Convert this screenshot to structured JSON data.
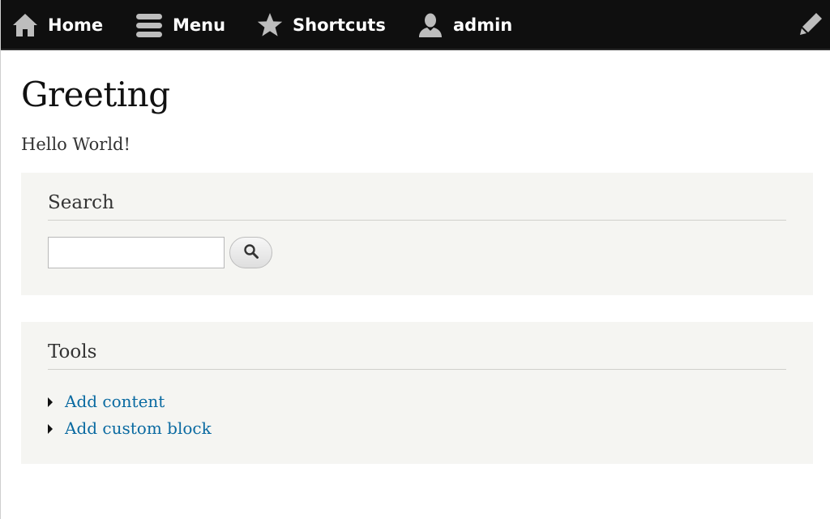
{
  "toolbar": {
    "background": "#0f0f0f",
    "items": [
      {
        "label": "Home",
        "icon": "home-icon"
      },
      {
        "label": "Menu",
        "icon": "hamburger-menu-icon"
      },
      {
        "label": "Shortcuts",
        "icon": "star-icon"
      },
      {
        "label": "admin",
        "icon": "user-icon"
      }
    ],
    "edit_icon": "pencil-icon"
  },
  "main": {
    "title": "Greeting",
    "body_text": "Hello World!"
  },
  "search_block": {
    "title": "Search",
    "input_value": "",
    "button_icon": "search-icon"
  },
  "tools_block": {
    "title": "Tools",
    "links": [
      {
        "label": "Add content"
      },
      {
        "label": "Add custom block"
      }
    ],
    "link_color": "#0a6aa1"
  }
}
